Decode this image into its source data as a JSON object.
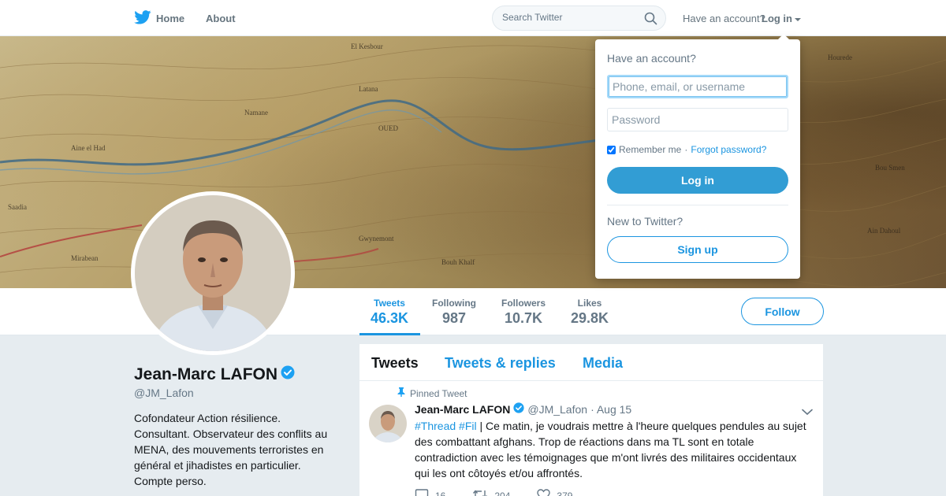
{
  "nav": {
    "home_label": "Home",
    "about_label": "About",
    "search_placeholder": "Search Twitter",
    "have_account": "Have an account?",
    "login_label": "Log in"
  },
  "colors": {
    "accent": "#1b95e0",
    "login_button": "#329dd4"
  },
  "icons": {
    "logo": "twitter-bird-icon",
    "search": "search-icon",
    "caret": "caret-down-icon",
    "verified": "verified-badge-icon",
    "pin": "pin-icon",
    "chevron": "chevron-down-icon",
    "reply": "reply-icon",
    "retweet": "retweet-icon",
    "like": "heart-icon"
  },
  "stats": [
    {
      "label": "Tweets",
      "value": "46.3K",
      "active": true
    },
    {
      "label": "Following",
      "value": "987",
      "active": false
    },
    {
      "label": "Followers",
      "value": "10.7K",
      "active": false
    },
    {
      "label": "Likes",
      "value": "29.8K",
      "active": false
    }
  ],
  "follow_label": "Follow",
  "profile": {
    "name": "Jean-Marc LAFON",
    "handle": "@JM_Lafon",
    "bio": "Cofondateur Action résilience. Consultant. Observateur des conflits au MENA, des mouvements terroristes en général et jihadistes en particulier. Compte perso."
  },
  "tabs": [
    "Tweets",
    "Tweets & replies",
    "Media"
  ],
  "tweet": {
    "pinned_label": "Pinned Tweet",
    "name": "Jean-Marc LAFON",
    "handle": "@JM_Lafon",
    "date": "· Aug 15",
    "hashtag1": "#Thread",
    "hashtag2": "#Fil",
    "text": " | Ce matin, je voudrais mettre à l'heure quelques pendules au sujet des combattant afghans. Trop de réactions dans ma TL sont en totale contradiction avec les témoignages que m'ont livrés des militaires occidentaux qui les ont côtoyés et/ou affrontés.",
    "reply_count": "16",
    "retweet_count": "204",
    "like_count": "379"
  },
  "login_dropdown": {
    "title": "Have an account?",
    "username_placeholder": "Phone, email, or username",
    "password_placeholder": "Password",
    "remember_label": "Remember me",
    "separator": "·",
    "forgot_label": "Forgot password?",
    "login_button": "Log in",
    "new_label": "New to Twitter?",
    "signup_button": "Sign up"
  }
}
